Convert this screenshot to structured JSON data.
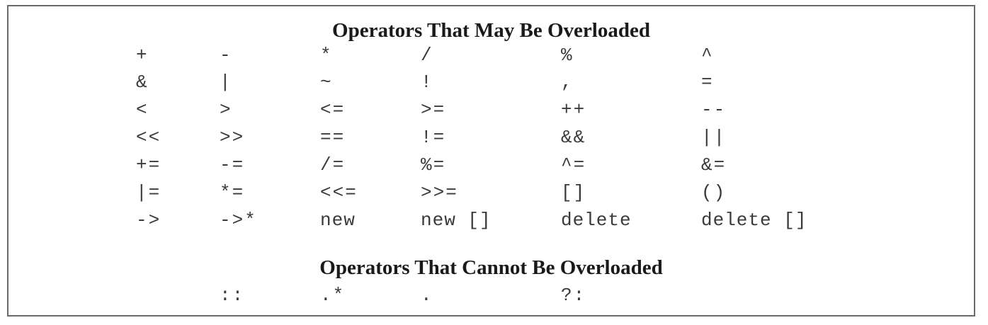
{
  "may_heading": "Operators That May Be Overloaded",
  "cannot_heading": "Operators That Cannot Be Overloaded",
  "may_rows": [
    [
      "+",
      "-",
      "*",
      "/",
      "%",
      "^"
    ],
    [
      "&",
      "|",
      "~",
      "!",
      ",",
      "="
    ],
    [
      "<",
      ">",
      "<=",
      ">=",
      "++",
      "--"
    ],
    [
      "<<",
      ">>",
      "==",
      "!=",
      "&&",
      "||"
    ],
    [
      "+=",
      "-=",
      "/=",
      "%=",
      "^=",
      "&="
    ],
    [
      "|=",
      "*=",
      "<<=",
      ">>=",
      "[]",
      "()"
    ],
    [
      "->",
      "->*",
      "new",
      "new []",
      "delete",
      "delete []"
    ]
  ],
  "cannot_row": [
    "::",
    ".*",
    ".",
    "?:"
  ]
}
